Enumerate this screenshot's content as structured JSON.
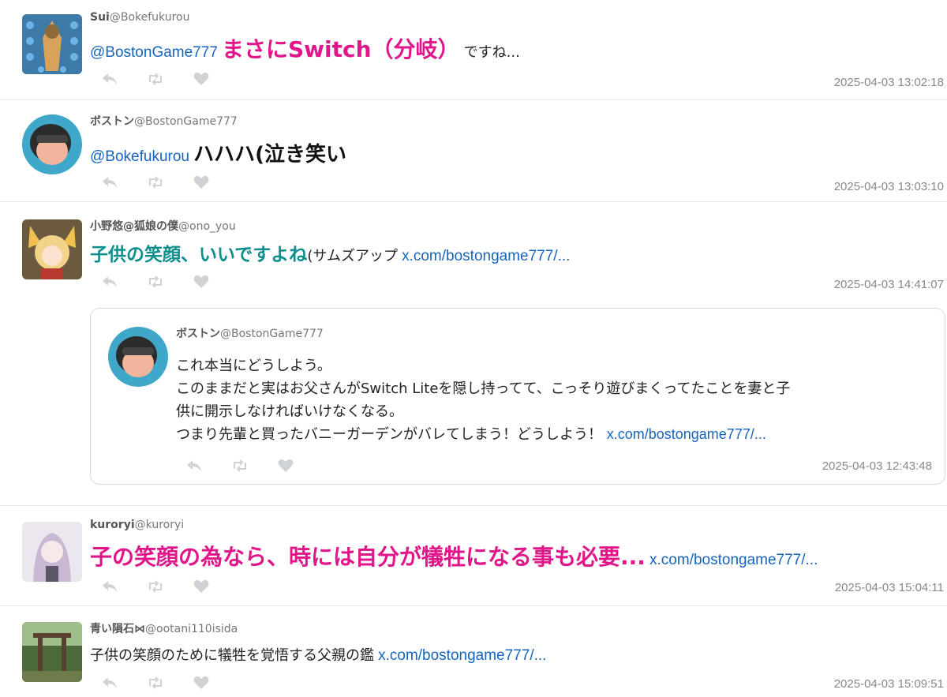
{
  "tweets": [
    {
      "name": "Sui",
      "handle": "@Bokefukurou",
      "mention": "@BostonGame777",
      "emph": "まさにSwitch（分岐）",
      "rest": "ですね...",
      "timestamp": "2025-04-03 13:02:18"
    },
    {
      "name": "ボストン",
      "handle": "@BostonGame777",
      "mention": "@Bokefukurou",
      "emph": "ハハハ(泣き笑い",
      "timestamp": "2025-04-03 13:03:10"
    },
    {
      "name": "小野悠@狐娘の僕",
      "handle": "@ono_you",
      "emph": "子供の笑顔、いいですよね",
      "rest": "(サムズアップ",
      "link": "x.com/bostongame777/...",
      "timestamp": "2025-04-03 14:41:07"
    },
    {
      "name": "kuroryi",
      "handle": "@kuroryi",
      "emph": "子の笑顔の為なら、時には自分が犠牲になる事も必要...",
      "link": "x.com/bostongame777/...",
      "timestamp": "2025-04-03 15:04:11"
    },
    {
      "name": "青い隕石⋈",
      "handle": "@ootani110isida",
      "rest": "子供の笑顔のために犠牲を覚悟する父親の鑑",
      "link": "x.com/bostongame777/...",
      "timestamp": "2025-04-03 15:09:51"
    }
  ],
  "quote": {
    "name": "ボストン",
    "handle": "@BostonGame777",
    "lines": [
      "これ本当にどうしよう。",
      "このままだと実はお父さんがSwitch Liteを隠し持ってて、こっそり遊びまくってたことを妻と子",
      "供に開示しなければいけなくなる。",
      "つまり先輩と買ったバニーガーデンがバレてしまう！どうしよう！"
    ],
    "link": "x.com/bostongame777/...",
    "timestamp": "2025-04-03 12:43:48"
  },
  "colors": {
    "accent_pink": "#e0168a",
    "accent_teal": "#0f8e8e",
    "link": "#1565c0",
    "icon_gray": "#cfd3d6"
  },
  "icons": [
    "reply-icon",
    "retweet-icon",
    "like-icon"
  ]
}
